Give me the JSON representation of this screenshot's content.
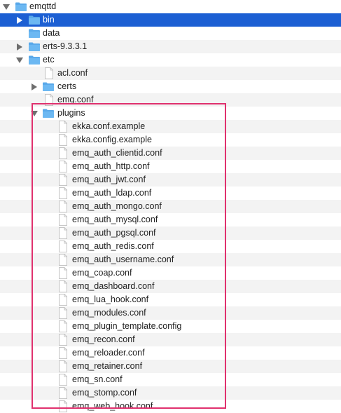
{
  "tree": {
    "root": {
      "label": "emqttd",
      "expanded": true
    },
    "bin": {
      "label": "bin",
      "expanded": false,
      "selected": true
    },
    "data": {
      "label": "data"
    },
    "erts": {
      "label": "erts-9.3.3.1",
      "expanded": false
    },
    "etc": {
      "label": "etc",
      "expanded": true
    },
    "etc_files": {
      "acl": "acl.conf",
      "certs": "certs",
      "emq": "emq.conf"
    },
    "plugins": {
      "label": "plugins",
      "expanded": true,
      "files": [
        "ekka.conf.example",
        "ekka.config.example",
        "emq_auth_clientid.conf",
        "emq_auth_http.conf",
        "emq_auth_jwt.conf",
        "emq_auth_ldap.conf",
        "emq_auth_mongo.conf",
        "emq_auth_mysql.conf",
        "emq_auth_pgsql.conf",
        "emq_auth_redis.conf",
        "emq_auth_username.conf",
        "emq_coap.conf",
        "emq_dashboard.conf",
        "emq_lua_hook.conf",
        "emq_modules.conf",
        "emq_plugin_template.config",
        "emq_recon.conf",
        "emq_reloader.conf",
        "emq_retainer.conf",
        "emq_sn.conf",
        "emq_stomp.conf",
        "emq_web_hook.conf"
      ]
    }
  },
  "colors": {
    "selection": "#1c5fd3",
    "folder": "#5aa9ea",
    "highlight_border": "#e0316e",
    "alt_row": "#f3f3f3"
  }
}
